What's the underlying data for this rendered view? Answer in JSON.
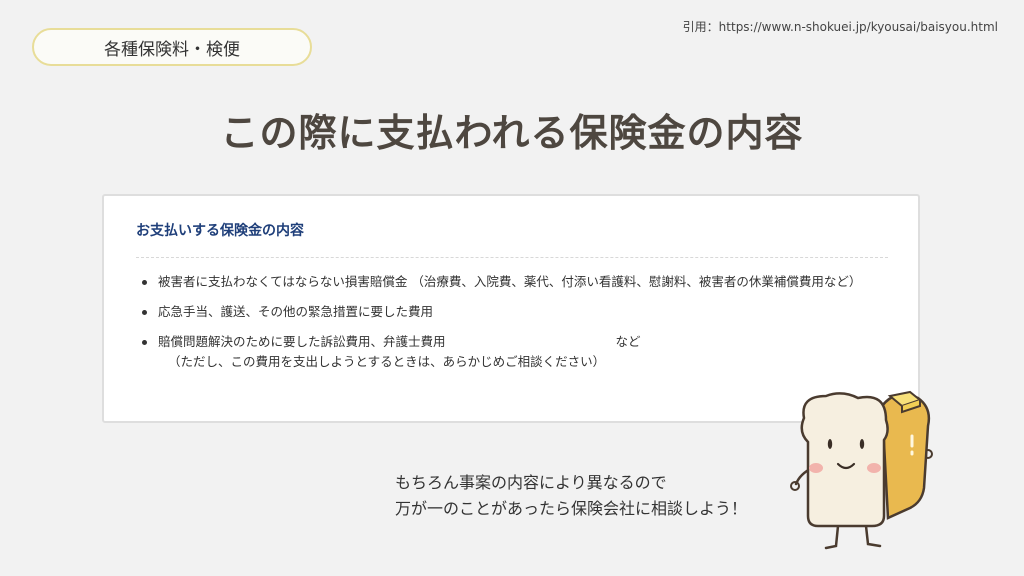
{
  "citation": "引用：https://www.n-shokuei.jp/kyousai/baisyou.html",
  "category": "各種保険料・検便",
  "title": "この際に支払われる保険金の内容",
  "card": {
    "heading": "お支払いする保険金の内容",
    "items": [
      {
        "text": "被害者に支払わなくてはならない損害賠償金 （治療費、入院費、薬代、付添い看護料、慰謝料、被害者の休業補償費用など）"
      },
      {
        "text": "応急手当、護送、その他の緊急措置に要した費用"
      },
      {
        "text": "賠償問題解決のために要した訴訟費用、弁護士費用",
        "etc": "など",
        "note": "（ただし、この費用を支出しようとするときは、あらかじめご相談ください）"
      }
    ]
  },
  "message": {
    "line1": "もちろん事案の内容により異なるので",
    "line2": "万が一のことがあったら保険会社に相談しよう！"
  },
  "colors": {
    "background": "#f2f2f2",
    "pill_border": "#e8dd98",
    "title": "#4e4740",
    "card_heading": "#1f3f7a"
  },
  "icons": {
    "mascot": "bread-mascot-icon"
  }
}
